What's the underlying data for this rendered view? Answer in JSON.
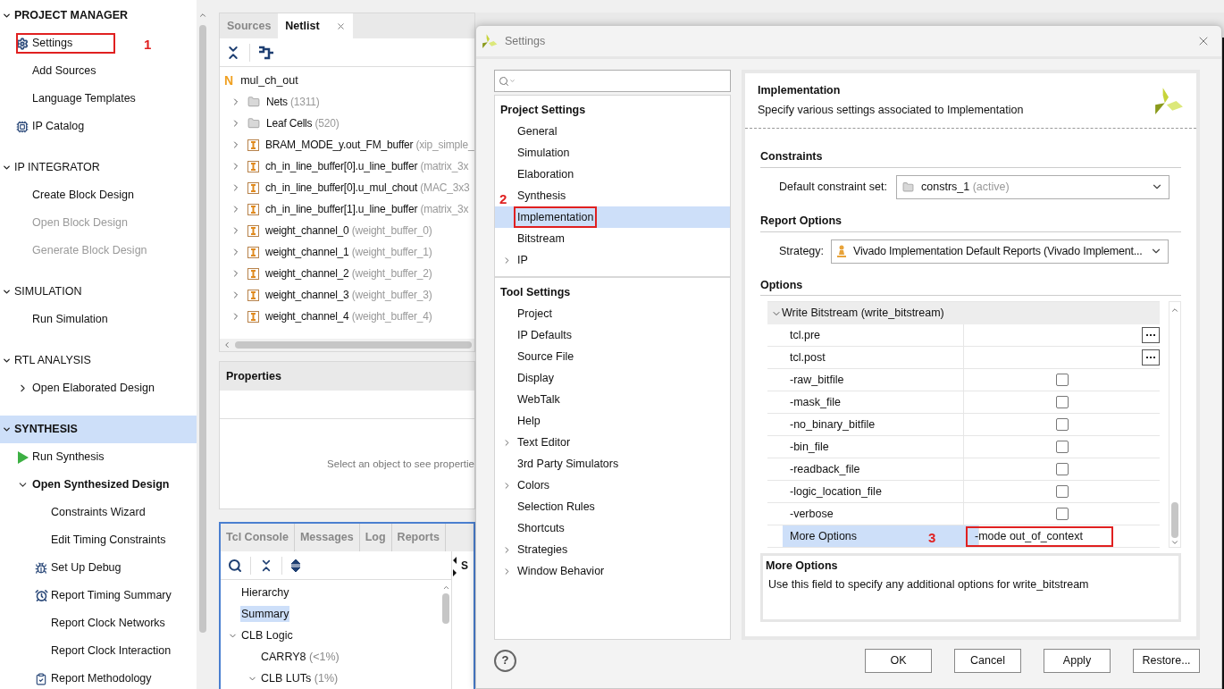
{
  "navigator": {
    "sections": [
      {
        "title": "PROJECT MANAGER",
        "expanded": true,
        "selected": false,
        "active": true,
        "items": [
          {
            "label": "Settings",
            "kind": "settings",
            "disabled": false,
            "active": false,
            "annotation": "1"
          },
          {
            "label": "Add Sources",
            "kind": "plain",
            "disabled": false,
            "active": false
          },
          {
            "label": "Language Templates",
            "kind": "plain",
            "disabled": false,
            "active": false
          },
          {
            "label": "IP Catalog",
            "kind": "chip",
            "disabled": false,
            "active": false
          }
        ]
      },
      {
        "title": "IP INTEGRATOR",
        "expanded": true,
        "selected": false,
        "active": false,
        "items": [
          {
            "label": "Create Block Design",
            "kind": "plain",
            "disabled": false,
            "active": false
          },
          {
            "label": "Open Block Design",
            "kind": "plain",
            "disabled": true,
            "active": false
          },
          {
            "label": "Generate Block Design",
            "kind": "plain",
            "disabled": true,
            "active": false
          }
        ]
      },
      {
        "title": "SIMULATION",
        "expanded": true,
        "selected": false,
        "active": false,
        "items": [
          {
            "label": "Run Simulation",
            "kind": "plain",
            "disabled": false,
            "active": false
          }
        ]
      },
      {
        "title": "RTL ANALYSIS",
        "expanded": true,
        "selected": false,
        "active": false,
        "items": [
          {
            "label": "Open Elaborated Design",
            "disabled": false,
            "active": false,
            "expanded": false
          }
        ]
      },
      {
        "title": "SYNTHESIS",
        "expanded": true,
        "selected": true,
        "active": true,
        "items": [
          {
            "label": "Run Synthesis",
            "kind": "run",
            "disabled": false,
            "active": false
          },
          {
            "label": "Open Synthesized Design",
            "disabled": false,
            "active": true,
            "expanded": true,
            "children": [
              {
                "label": "Constraints Wizard",
                "kind": "plain",
                "disabled": false,
                "active": false
              },
              {
                "label": "Edit Timing Constraints",
                "kind": "plain",
                "disabled": false,
                "active": false
              },
              {
                "label": "Set Up Debug",
                "kind": "bug",
                "disabled": false,
                "active": false
              },
              {
                "label": "Report Timing Summary",
                "kind": "clock",
                "disabled": false,
                "active": false
              },
              {
                "label": "Report Clock Networks",
                "kind": "plain",
                "disabled": false,
                "active": false
              },
              {
                "label": "Report Clock Interaction",
                "kind": "plain",
                "disabled": false,
                "active": false
              },
              {
                "label": "Report Methodology",
                "kind": "clipboard",
                "disabled": false,
                "active": false
              }
            ]
          }
        ]
      }
    ]
  },
  "netlist_panel": {
    "tabs": [
      {
        "label": "Sources",
        "selected": false
      },
      {
        "label": "Netlist",
        "selected": true
      }
    ],
    "root": {
      "badge": "N",
      "name": "mul_ch_out"
    },
    "rows": [
      {
        "name": "Nets",
        "detail": "(1311)",
        "kind": "folder",
        "expanded": false
      },
      {
        "name": "Leaf Cells",
        "detail": "(520)",
        "kind": "folder",
        "expanded": false
      },
      {
        "name": "BRAM_MODE_y.out_FM_buffer",
        "detail": "(xip_simple_",
        "kind": "instance",
        "expanded": false
      },
      {
        "name": "ch_in_line_buffer[0].u_line_buffer",
        "detail": "(matrix_3x",
        "kind": "instance",
        "expanded": false
      },
      {
        "name": "ch_in_line_buffer[0].u_mul_chout",
        "detail": "(MAC_3x3",
        "kind": "instance",
        "expanded": false
      },
      {
        "name": "ch_in_line_buffer[1].u_line_buffer",
        "detail": "(matrix_3x",
        "kind": "instance",
        "expanded": false
      },
      {
        "name": "weight_channel_0",
        "detail": "(weight_buffer_0)",
        "kind": "instance",
        "expanded": false
      },
      {
        "name": "weight_channel_1",
        "detail": "(weight_buffer_1)",
        "kind": "instance",
        "expanded": false
      },
      {
        "name": "weight_channel_2",
        "detail": "(weight_buffer_2)",
        "kind": "instance",
        "expanded": false
      },
      {
        "name": "weight_channel_3",
        "detail": "(weight_buffer_3)",
        "kind": "instance",
        "expanded": false
      },
      {
        "name": "weight_channel_4",
        "detail": "(weight_buffer_4)",
        "kind": "instance",
        "expanded": false
      }
    ]
  },
  "properties": {
    "title": "Properties",
    "message": "Select an object to see propertie"
  },
  "tcl_panel": {
    "tabs": [
      {
        "label": "Tcl Console",
        "selected": false
      },
      {
        "label": "Messages",
        "selected": false
      },
      {
        "label": "Log",
        "selected": false
      },
      {
        "label": "Reports",
        "selected": false
      }
    ],
    "side_header": "S",
    "tree": [
      {
        "label": "Hierarchy",
        "selected": false
      },
      {
        "label": "Summary",
        "selected": true
      },
      {
        "label": "CLB Logic",
        "selected": false,
        "expanded": true,
        "children": [
          {
            "label": "CARRY8",
            "detail": "(<1%)",
            "selected": false
          },
          {
            "label": "CLB LUTs",
            "detail": "(1%)",
            "selected": false,
            "expanded": true
          }
        ]
      }
    ]
  },
  "dialog": {
    "title": "Settings",
    "nav": [
      {
        "heading": "Project Settings",
        "items": [
          {
            "label": "General",
            "selected": false
          },
          {
            "label": "Simulation",
            "selected": false
          },
          {
            "label": "Elaboration",
            "selected": false
          },
          {
            "label": "Synthesis",
            "selected": false
          },
          {
            "label": "Implementation",
            "selected": true,
            "annotation": "2"
          },
          {
            "label": "Bitstream",
            "selected": false
          },
          {
            "label": "IP",
            "selected": false,
            "expanded": false
          }
        ]
      },
      {
        "heading": "Tool Settings",
        "items": [
          {
            "label": "Project",
            "selected": false
          },
          {
            "label": "IP Defaults",
            "selected": false
          },
          {
            "label": "Source File",
            "selected": false
          },
          {
            "label": "Display",
            "selected": false
          },
          {
            "label": "WebTalk",
            "selected": false
          },
          {
            "label": "Help",
            "selected": false
          },
          {
            "label": "Text Editor",
            "selected": false,
            "expanded": false
          },
          {
            "label": "3rd Party Simulators",
            "selected": false
          },
          {
            "label": "Colors",
            "selected": false,
            "expanded": false
          },
          {
            "label": "Selection Rules",
            "selected": false
          },
          {
            "label": "Shortcuts",
            "selected": false
          },
          {
            "label": "Strategies",
            "selected": false,
            "expanded": false
          },
          {
            "label": "Window Behavior",
            "selected": false,
            "expanded": false
          }
        ]
      }
    ],
    "page": {
      "title": "Implementation",
      "description": "Specify various settings associated to Implementation"
    },
    "constraints": {
      "heading": "Constraints",
      "label": "Default constraint set:",
      "value": "constrs_1",
      "note": "(active)"
    },
    "report_options": {
      "heading": "Report Options",
      "label": "Strategy:",
      "value": "Vivado Implementation Default Reports (Vivado Implement..."
    },
    "options": {
      "heading": "Options",
      "group": {
        "label": "Write Bitstream (write_bitstream)",
        "expanded": true
      },
      "rows": [
        {
          "name": "tcl.pre",
          "kind": "file",
          "selected": false
        },
        {
          "name": "tcl.post",
          "kind": "file",
          "selected": false
        },
        {
          "name": "-raw_bitfile",
          "kind": "checkbox",
          "checked": false,
          "selected": false
        },
        {
          "name": "-mask_file",
          "kind": "checkbox",
          "checked": false,
          "selected": false
        },
        {
          "name": "-no_binary_bitfile",
          "kind": "checkbox",
          "checked": false,
          "selected": false
        },
        {
          "name": "-bin_file",
          "kind": "checkbox",
          "checked": false,
          "selected": false
        },
        {
          "name": "-readback_file",
          "kind": "checkbox",
          "checked": false,
          "selected": false
        },
        {
          "name": "-logic_location_file",
          "kind": "checkbox",
          "checked": false,
          "selected": false
        },
        {
          "name": "-verbose",
          "kind": "checkbox",
          "checked": false,
          "selected": false
        },
        {
          "name": "More Options",
          "kind": "text",
          "value": "-mode out_of_context",
          "selected": true,
          "annotation": "3"
        }
      ]
    },
    "description": {
      "title": "More Options",
      "text": "Use this field to specify any additional options for write_bitstream"
    },
    "help": "?",
    "buttons": [
      {
        "label": "OK"
      },
      {
        "label": "Cancel"
      },
      {
        "label": "Apply"
      },
      {
        "label": "Restore..."
      }
    ]
  }
}
